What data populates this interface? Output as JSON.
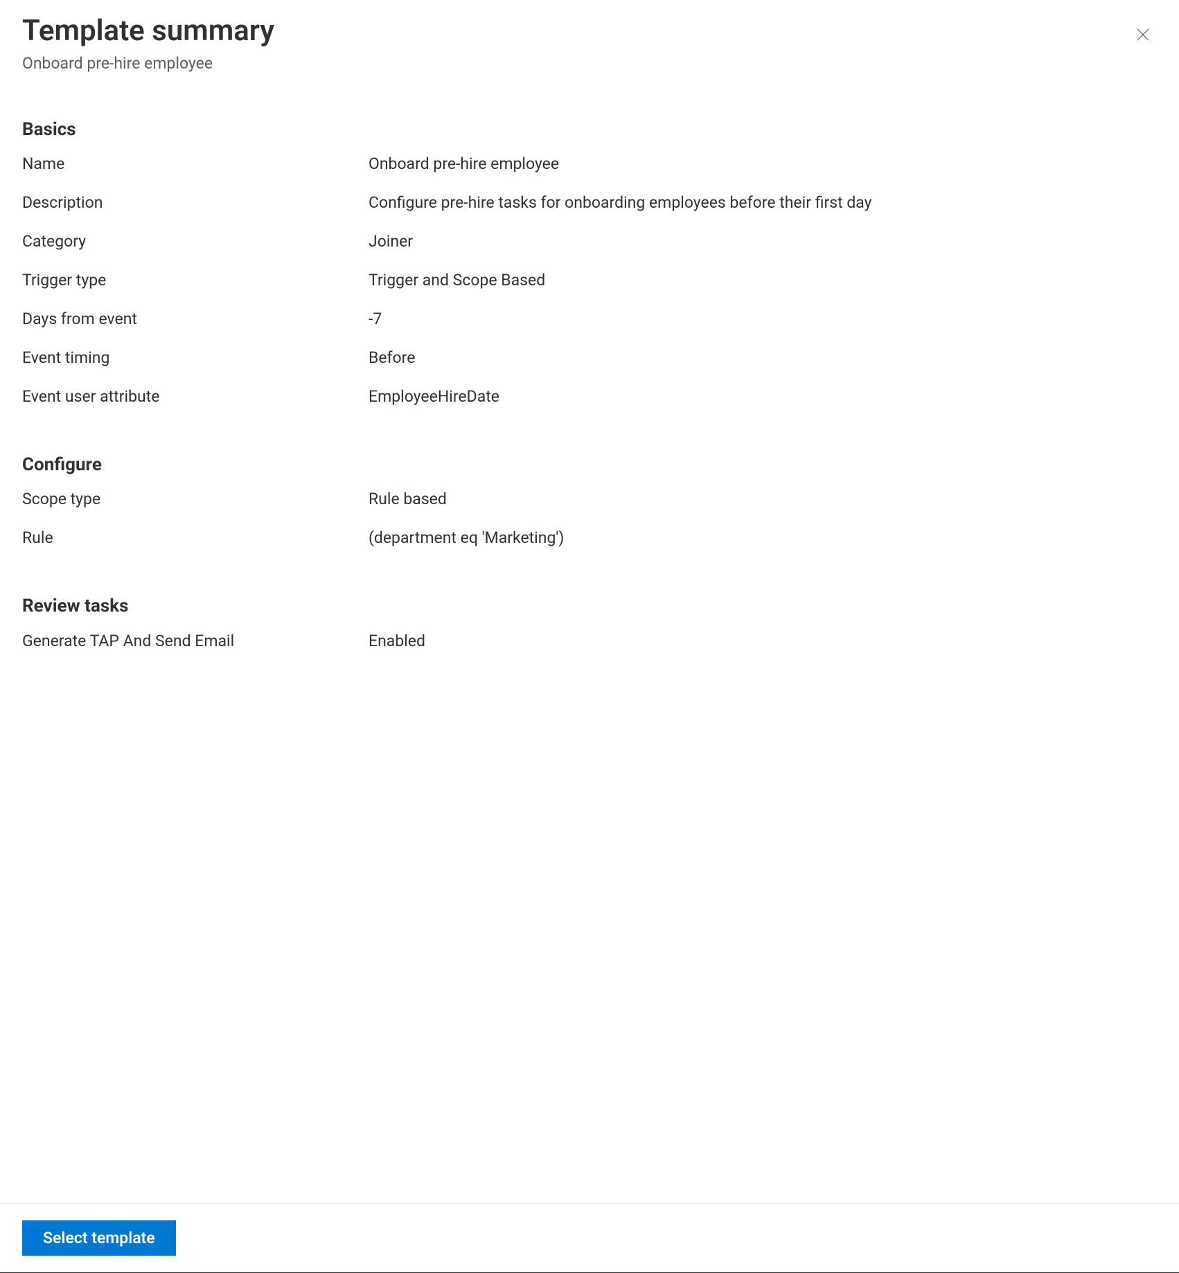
{
  "header": {
    "title": "Template summary",
    "subtitle": "Onboard pre-hire employee"
  },
  "sections": {
    "basics": {
      "heading": "Basics",
      "rows": [
        {
          "label": "Name",
          "value": "Onboard pre-hire employee"
        },
        {
          "label": "Description",
          "value": "Configure pre-hire tasks for onboarding employees before their first day"
        },
        {
          "label": "Category",
          "value": "Joiner"
        },
        {
          "label": "Trigger type",
          "value": "Trigger and Scope Based"
        },
        {
          "label": "Days from event",
          "value": "-7"
        },
        {
          "label": "Event timing",
          "value": "Before"
        },
        {
          "label": "Event user attribute",
          "value": "EmployeeHireDate"
        }
      ]
    },
    "configure": {
      "heading": "Configure",
      "rows": [
        {
          "label": "Scope type",
          "value": "Rule based"
        },
        {
          "label": "Rule",
          "value": "(department eq 'Marketing')"
        }
      ]
    },
    "reviewTasks": {
      "heading": "Review tasks",
      "rows": [
        {
          "label": "Generate TAP And Send Email",
          "value": "Enabled"
        }
      ]
    }
  },
  "footer": {
    "primary_button": "Select template"
  }
}
